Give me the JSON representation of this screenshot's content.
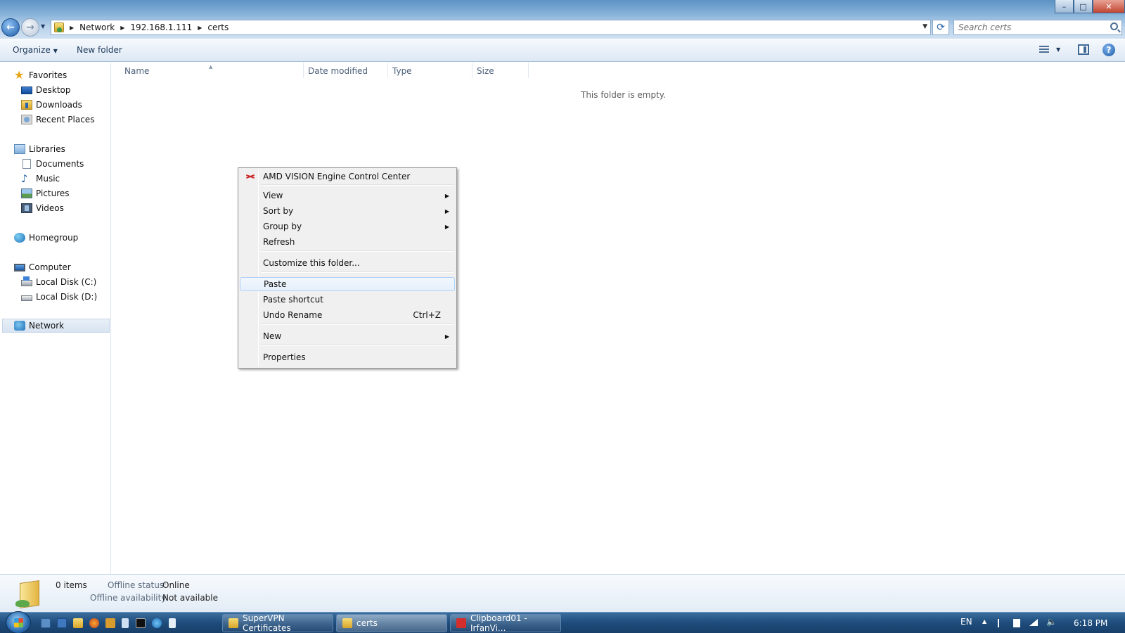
{
  "window": {
    "min_label": "–",
    "max_label": "□",
    "close_label": "✕"
  },
  "address": {
    "crumbs": [
      "Network",
      "192.168.1.111",
      "certs"
    ],
    "search_placeholder": "Search certs"
  },
  "toolbar": {
    "organize_label": "Organize",
    "new_folder_label": "New folder"
  },
  "nav": {
    "favorites": "Favorites",
    "desktop": "Desktop",
    "downloads": "Downloads",
    "recent_places": "Recent Places",
    "libraries": "Libraries",
    "documents": "Documents",
    "music": "Music",
    "pictures": "Pictures",
    "videos": "Videos",
    "homegroup": "Homegroup",
    "computer": "Computer",
    "local_disk_c": "Local Disk (C:)",
    "local_disk_d": "Local Disk (D:)",
    "network": "Network"
  },
  "columns": {
    "name": "Name",
    "date_modified": "Date modified",
    "type": "Type",
    "size": "Size"
  },
  "content": {
    "empty_message": "This folder is empty."
  },
  "context_menu": {
    "amd": "AMD VISION Engine Control Center",
    "view": "View",
    "sort_by": "Sort by",
    "group_by": "Group by",
    "refresh": "Refresh",
    "customize": "Customize this folder...",
    "paste": "Paste",
    "paste_shortcut": "Paste shortcut",
    "undo_rename": "Undo Rename",
    "undo_shortcut": "Ctrl+Z",
    "new": "New",
    "properties": "Properties",
    "highlighted_item": "Paste"
  },
  "details": {
    "item_count": "0 items",
    "offline_status_label": "Offline status:",
    "offline_status_value": "Online",
    "offline_availability_label": "Offline availability:",
    "offline_availability_value": "Not available"
  },
  "taskbar": {
    "tasks": [
      "SuperVPN Certificates",
      "certs",
      "Clipboard01 - IrfanVi..."
    ],
    "language": "EN",
    "clock": "6:18 PM"
  },
  "colors": {
    "selection_highlight": "#e5effb",
    "taskbar": "#1e4c7c",
    "title_gradient_top": "#5c93c4"
  }
}
